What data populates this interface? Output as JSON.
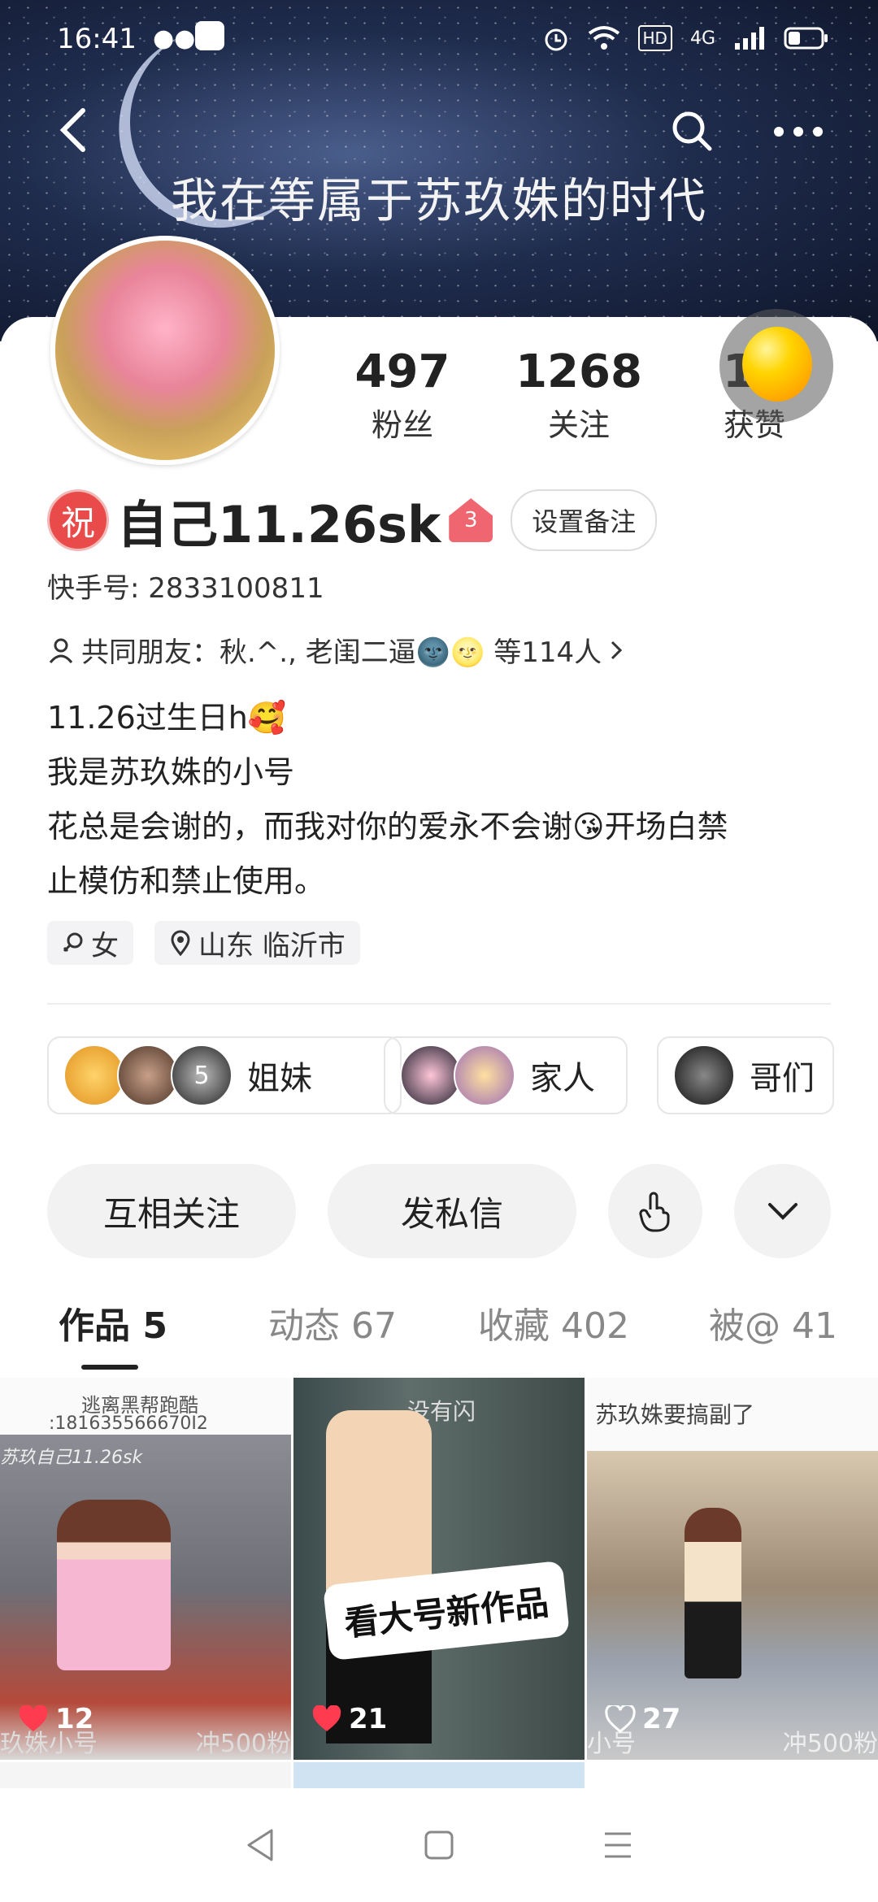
{
  "status_bar": {
    "time": "16:41",
    "network": "4G"
  },
  "header": {
    "title": "我在等属于苏玖姝的时代"
  },
  "stats": [
    {
      "value": "497",
      "label": "粉丝"
    },
    {
      "value": "1268",
      "label": "关注"
    },
    {
      "value": "11",
      "label": "获赞"
    }
  ],
  "profile": {
    "badge": "祝",
    "name": "自己11.26sk",
    "house_level": "3",
    "remark_button": "设置备注",
    "kuaishou_id": "快手号: 2833100811",
    "mutual_friends": "共同朋友：秋.^., 老闺二逼🌚🌝 等114人",
    "bio": [
      "11.26过生日h🥰",
      "我是苏玖姝的小号",
      "花总是会谢的，而我对你的爱永不会谢😘开场白禁",
      "止模仿和禁止使用。"
    ],
    "tags": [
      "女",
      "山东 临沂市"
    ]
  },
  "groups": [
    {
      "count": "5",
      "label": "姐妹"
    },
    {
      "label": "家人"
    },
    {
      "label": "哥们"
    }
  ],
  "actions": {
    "mutual_follow": "互相关注",
    "message": "发私信"
  },
  "tabs": [
    {
      "label": "作品 5"
    },
    {
      "label": "动态 67"
    },
    {
      "label": "收藏 402"
    },
    {
      "label": "被@ 41"
    }
  ],
  "videos": [
    {
      "likes": "12",
      "top_text": "逃离黑帮跑酷",
      "id_text": ":181635566670I2",
      "mid_text": "苏玖自己11.26sk",
      "bottom_left": "玖姝小号",
      "bottom_right": "冲500粉"
    },
    {
      "likes": "21",
      "top_text": "没有闪",
      "sticker": "看大号新作品"
    },
    {
      "likes": "27",
      "top_text": "苏玖姝要搞副了",
      "bottom_left": "小号",
      "bottom_right": "冲500粉"
    }
  ],
  "colors": {
    "accent_red": "#e94a4a",
    "heart": "#ff3b4f"
  }
}
